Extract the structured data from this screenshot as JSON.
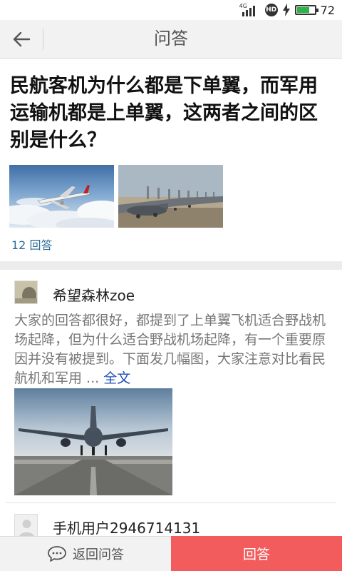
{
  "status_bar": {
    "network": "4G",
    "hd_label": "HD",
    "battery_level": 72,
    "battery_percent": "72"
  },
  "header": {
    "title": "问答",
    "back_icon": "arrow-left-icon"
  },
  "question": {
    "title": "民航客机为什么都是下单翼，而军用运输机都是上单翼，这两者之间的区别是什么？",
    "answer_count": "12 回答"
  },
  "answers": [
    {
      "user": "希望森林zoe",
      "text": "大家的回答都很好，都提到了上单翼飞机适合野战机场起降，但为什么适合野战机场起降，有一个重要原因并没有被提到。下面发几幅图，大家注意对比看民航机和军用 ...",
      "more_label": "全文"
    },
    {
      "user": "手机用户2946714131"
    }
  ],
  "bottom_bar": {
    "back_label": "返回问答",
    "answer_label": "回答"
  },
  "colors": {
    "accent": "#f25c5c",
    "link": "#1e4fb5",
    "count": "#2a6a96"
  }
}
